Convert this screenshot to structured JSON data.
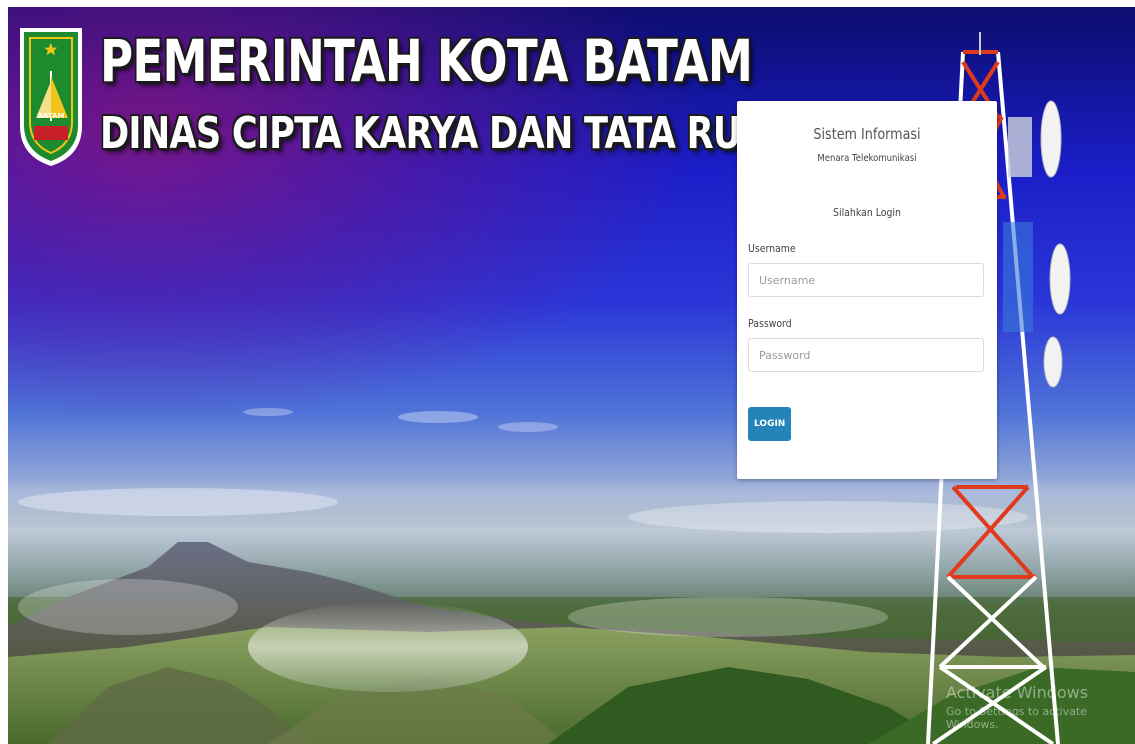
{
  "header": {
    "title_line1": "PEMERINTAH KOTA BATAM",
    "title_line2": "DINAS CIPTA KARYA DAN TATA RUANG",
    "logo_text": "BATAM"
  },
  "login_panel": {
    "system_title": "Sistem Informasi",
    "system_subtitle": "Menara Telekomunikasi",
    "prompt": "Silahkan Login",
    "username_label": "Username",
    "username_placeholder": "Username",
    "username_value": "",
    "password_label": "Password",
    "password_placeholder": "Password",
    "password_value": "",
    "login_button": "LOGIN"
  },
  "watermark": {
    "line1": "Activate Windows",
    "line2": "Go to Settings to activate Windows."
  },
  "colors": {
    "accent_button": "#2483b8",
    "sky_top": "#0b0d6e",
    "sky_mid": "#2a36d8",
    "tower_red": "#e03a1c"
  }
}
